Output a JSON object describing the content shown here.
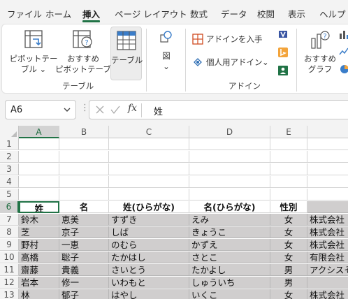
{
  "menu_tabs": [
    "ファイル",
    "ホーム",
    "挿入",
    "ページ レイアウト",
    "数式",
    "データ",
    "校閲",
    "表示",
    "ヘルプ"
  ],
  "active_tab": "挿入",
  "ribbon": {
    "pivot_table": [
      "ピボットテー",
      "ブル ⌄"
    ],
    "recommended_pivot": [
      "おすすめ",
      "ピボットテーブル"
    ],
    "table": "テーブル",
    "illustrations": [
      "図",
      "⌄"
    ],
    "group_tables": "テーブル",
    "get_addins": "アドインを入手",
    "my_addins": "個人用アドイン",
    "my_addins_arrow": "⌄",
    "group_addins": "アドイン",
    "recommended_charts": [
      "おすすめ",
      "グラフ"
    ]
  },
  "formula_bar": {
    "name_box": "A6",
    "fx": "fx",
    "value": "姓"
  },
  "columns": [
    "A",
    "B",
    "C",
    "D",
    "E",
    ""
  ],
  "rows": [
    "1",
    "2",
    "3",
    "4",
    "5",
    "6",
    "7",
    "8",
    "9",
    "10",
    "11",
    "12",
    "13"
  ],
  "table_header": [
    "姓",
    "名",
    "姓(ひらがな)",
    "名(ひらがな)",
    "性別",
    ""
  ],
  "table_rows": [
    [
      "鈴木",
      "恵美",
      "すずき",
      "えみ",
      "女",
      "株式会社"
    ],
    [
      "芝",
      "京子",
      "しば",
      "きょうこ",
      "女",
      "株式会社"
    ],
    [
      "野村",
      "一恵",
      "のむら",
      "かずえ",
      "女",
      "株式会社"
    ],
    [
      "高橋",
      "聡子",
      "たかはし",
      "さとこ",
      "女",
      "有限会社"
    ],
    [
      "齋藤",
      "貴義",
      "さいとう",
      "たかよし",
      "男",
      "アクシスそ"
    ],
    [
      "岩本",
      "修一",
      "いわもと",
      "しゅういち",
      "男",
      ""
    ],
    [
      "林",
      "郁子",
      "はやし",
      "いくこ",
      "女",
      "株式会社"
    ]
  ],
  "colors": {
    "accent": "#217346",
    "table_fill": "#d0cece"
  }
}
